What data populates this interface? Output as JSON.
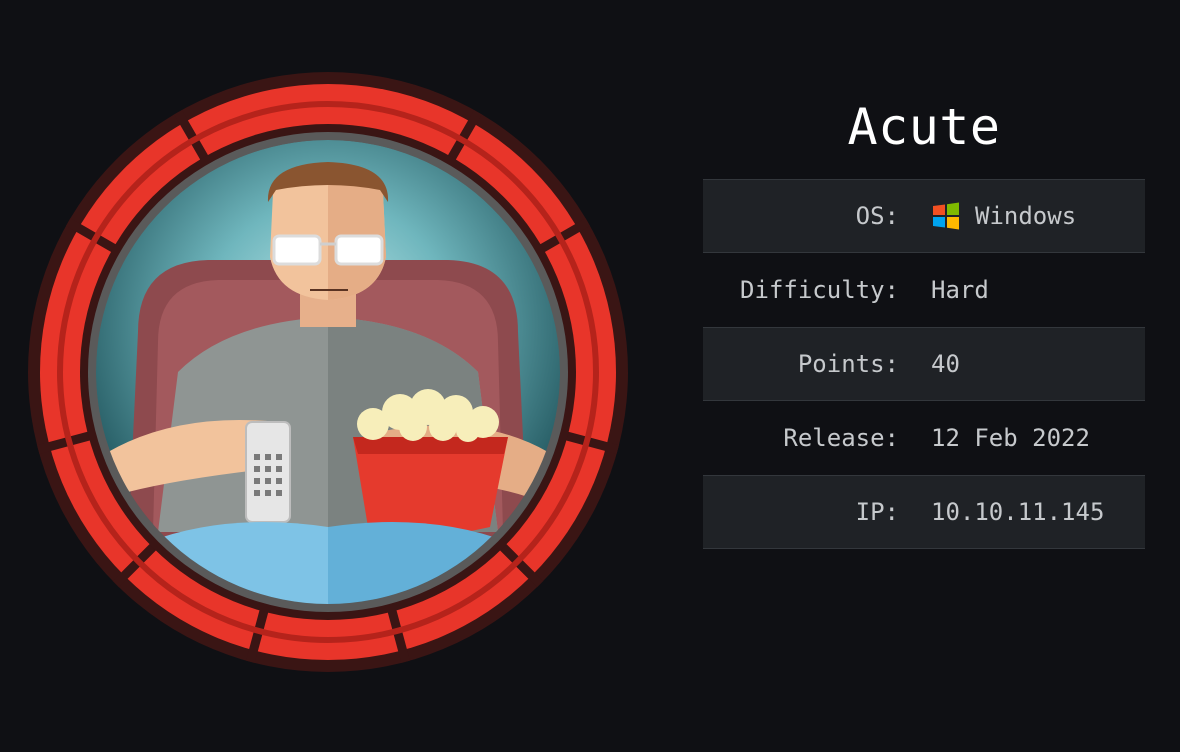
{
  "machine": {
    "name": "Acute"
  },
  "info": {
    "os_label": "OS:",
    "os_value": "Windows",
    "os_icon": "windows-logo-icon",
    "difficulty_label": "Difficulty:",
    "difficulty_value": "Hard",
    "points_label": "Points:",
    "points_value": "40",
    "release_label": "Release:",
    "release_value": "12 Feb 2022",
    "ip_label": "IP:",
    "ip_value": "10.10.11.145"
  },
  "colors": {
    "background": "#0f1014",
    "row_shade": "#1f2226",
    "text": "#c6c9cc",
    "difficulty_hard": "#e8554e",
    "points": "#9ccc3a",
    "avatar_ring": "#e8352a"
  }
}
